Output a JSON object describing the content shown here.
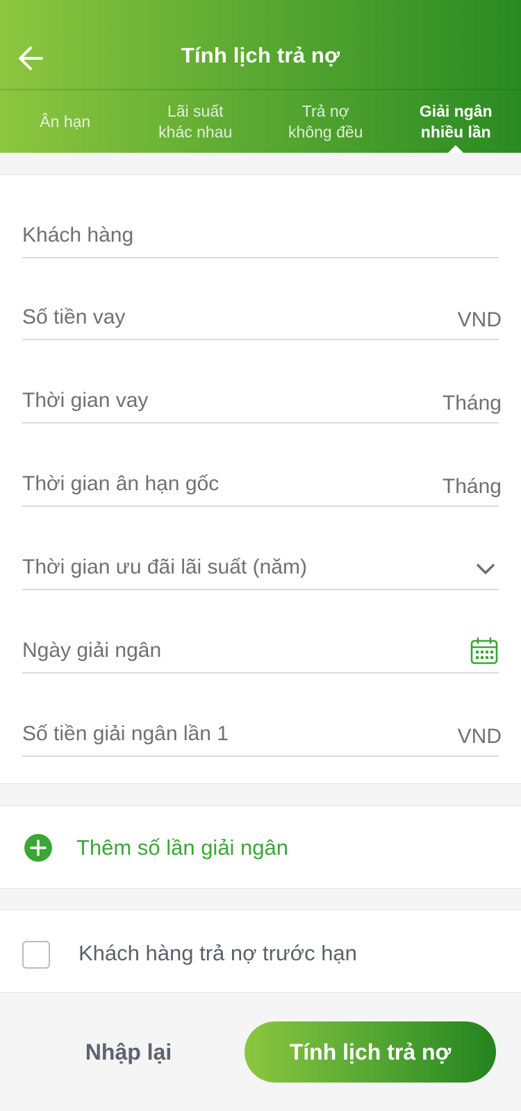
{
  "header": {
    "title": "Tính lịch trả nợ",
    "back_icon": "arrow-left-icon"
  },
  "tabs": [
    {
      "label": "Ân hạn",
      "active": false
    },
    {
      "label": "Lãi suất\nkhác nhau",
      "active": false
    },
    {
      "label": "Trả nợ\nkhông đều",
      "active": false
    },
    {
      "label": "Giải ngân\nnhiều lần",
      "active": true
    }
  ],
  "form": {
    "customer": {
      "label": "Khách hàng"
    },
    "loan_amount": {
      "label": "Số tiền vay",
      "suffix": "VND"
    },
    "loan_term": {
      "label": "Thời gian vay",
      "suffix": "Tháng"
    },
    "grace_period": {
      "label": "Thời gian ân hạn gốc",
      "suffix": "Tháng"
    },
    "rate_promo": {
      "label": "Thời gian ưu đãi lãi suất (năm)",
      "icon": "chevron-down-icon"
    },
    "disbursement_date": {
      "label": "Ngày giải ngân",
      "icon": "calendar-icon"
    },
    "disbursement_1": {
      "label": "Số tiền giải ngân lần 1",
      "suffix": "VND"
    }
  },
  "add_disbursement": {
    "label": "Thêm số lần giải ngân",
    "icon": "plus-circle-icon"
  },
  "early_repayment": {
    "label": "Khách hàng trả nợ trước hạn",
    "checked": false
  },
  "actions": {
    "reset_label": "Nhập lại",
    "calculate_label": "Tính lịch trả nợ"
  },
  "colors": {
    "brand_green": "#3aa635",
    "gradient_start": "#8dc63f",
    "gradient_end": "#23841f"
  }
}
